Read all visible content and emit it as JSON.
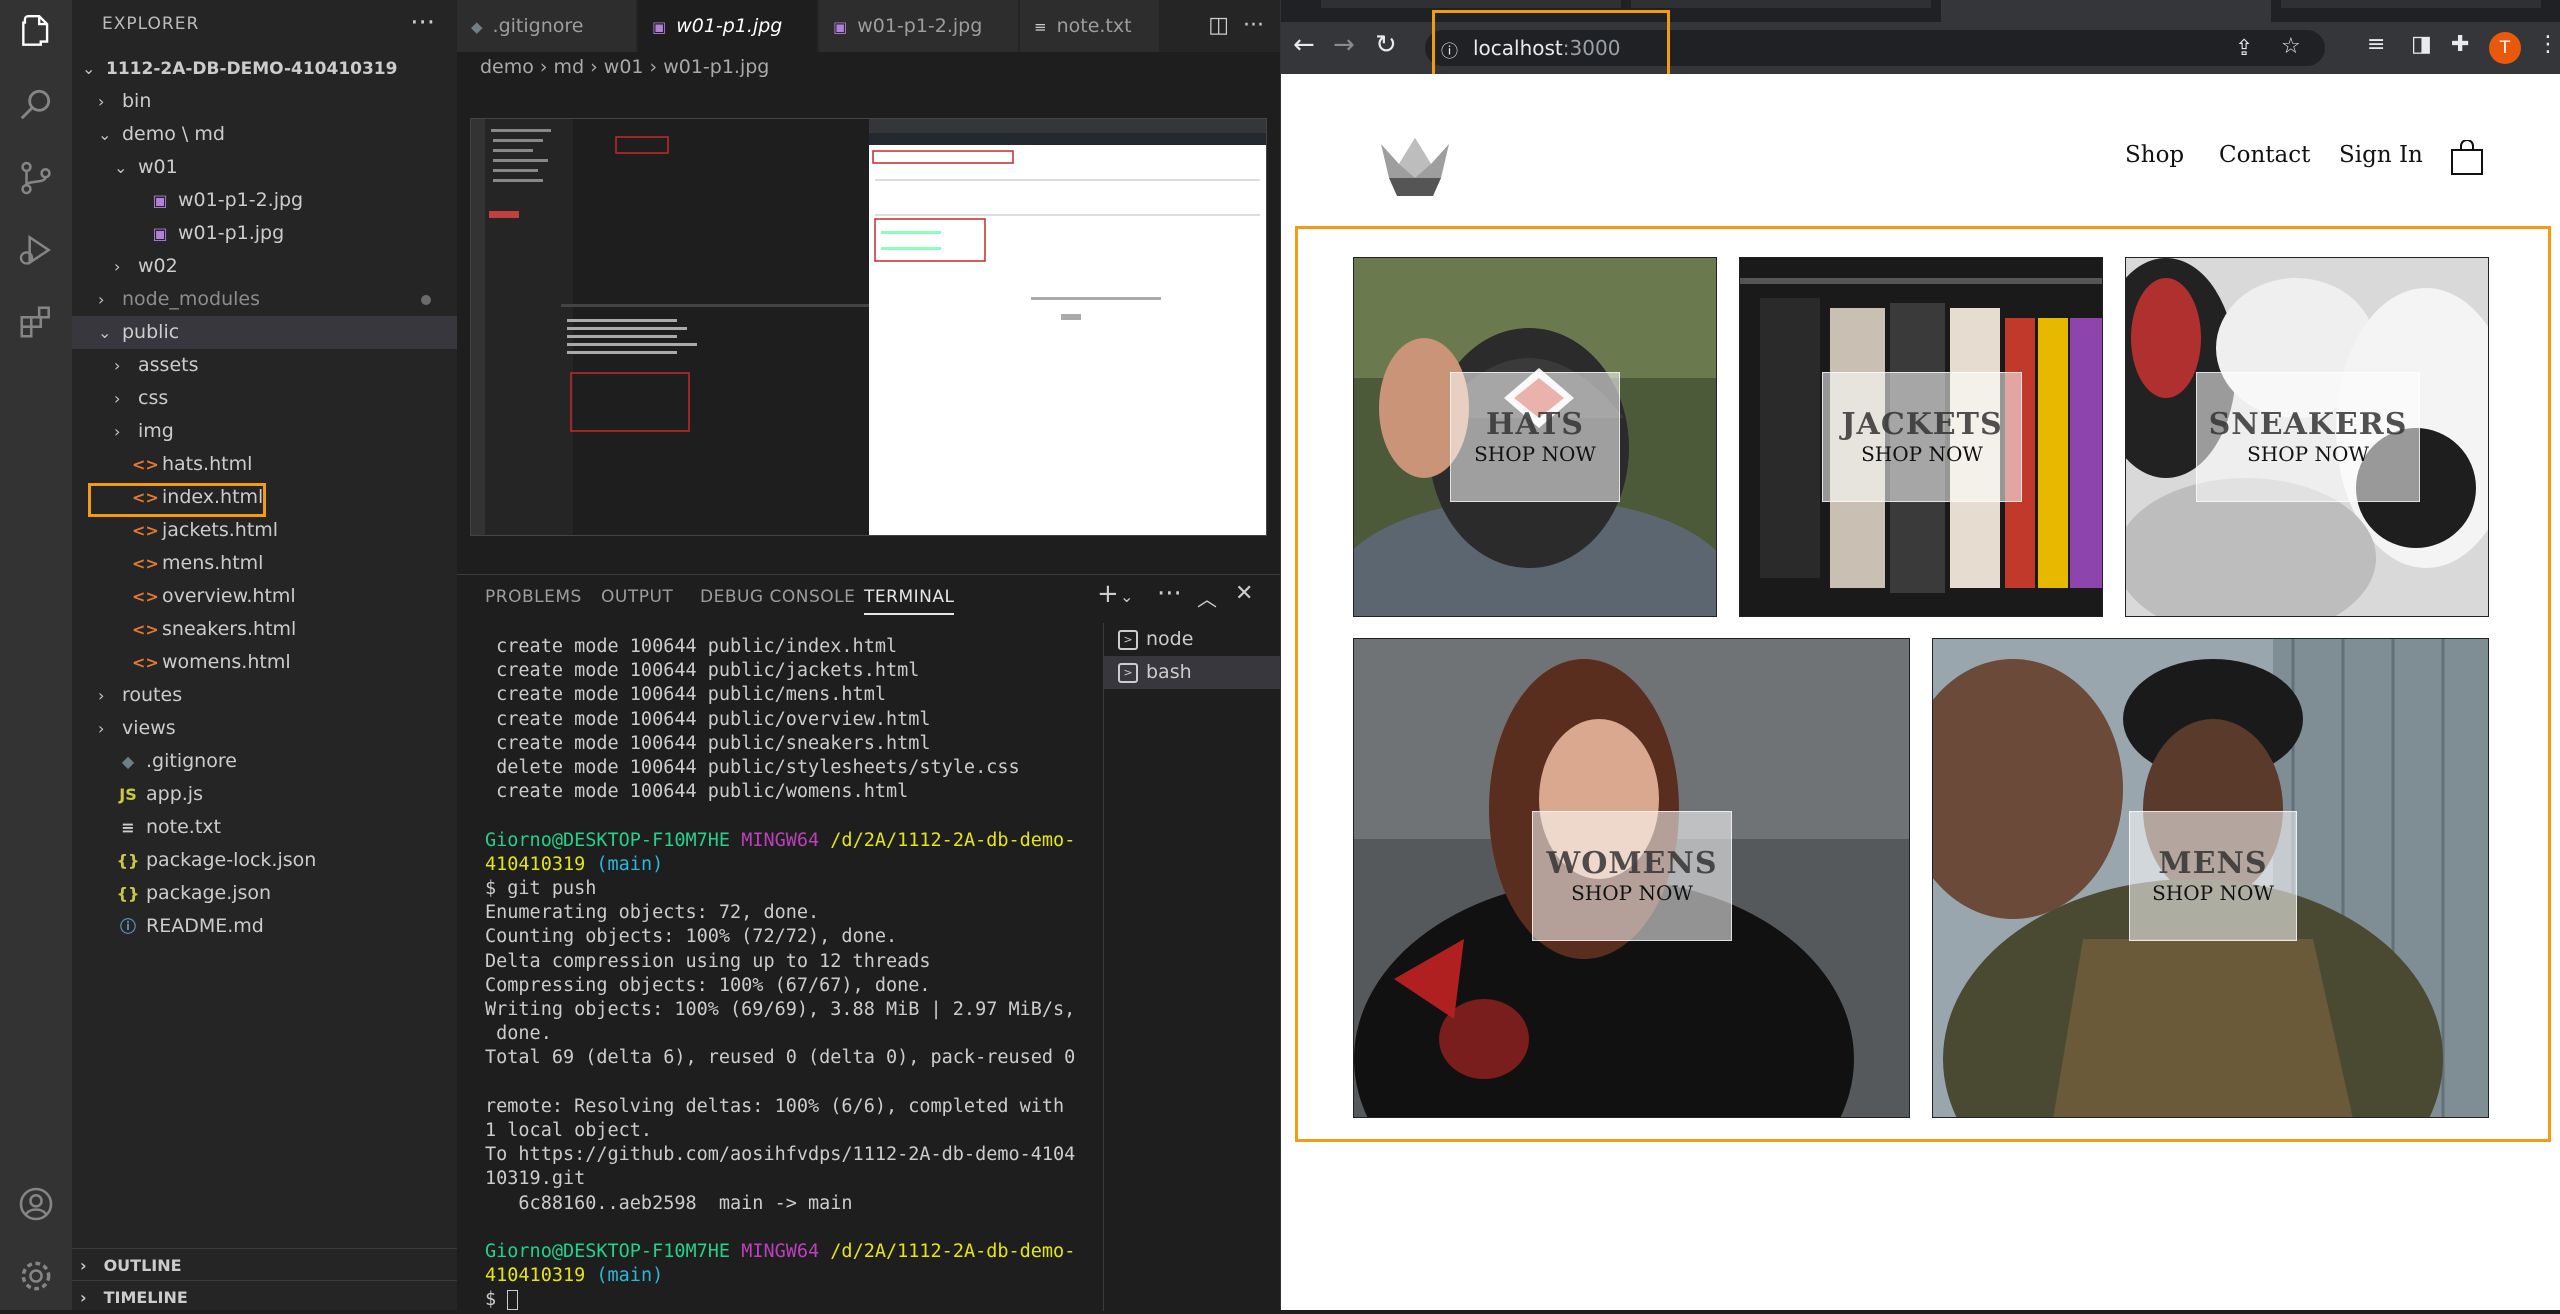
{
  "vscode": {
    "explorer_title": "EXPLORER",
    "more": "···",
    "tree": [
      {
        "label": "1112-2A-DB-DEMO-410410319",
        "chev": "⌄",
        "indent": 0,
        "icon": "",
        "bold": true
      },
      {
        "label": "bin",
        "chev": "›",
        "indent": 1,
        "icon": ""
      },
      {
        "label": "demo \\ md",
        "chev": "⌄",
        "indent": 1,
        "icon": ""
      },
      {
        "label": "w01",
        "chev": "⌄",
        "indent": 2,
        "icon": ""
      },
      {
        "label": "w01-p1-2.jpg",
        "chev": "",
        "indent": 3,
        "icon": "▣"
      },
      {
        "label": "w01-p1.jpg",
        "chev": "",
        "indent": 3,
        "icon": "▣"
      },
      {
        "label": "w02",
        "chev": "›",
        "indent": 2,
        "icon": ""
      },
      {
        "label": "node_modules",
        "chev": "›",
        "indent": 1,
        "icon": "",
        "dim": true
      },
      {
        "label": "public",
        "chev": "⌄",
        "indent": 1,
        "icon": "",
        "selected": true
      },
      {
        "label": "assets",
        "chev": "›",
        "indent": 2,
        "icon": ""
      },
      {
        "label": "css",
        "chev": "›",
        "indent": 2,
        "icon": ""
      },
      {
        "label": "img",
        "chev": "›",
        "indent": 2,
        "icon": ""
      },
      {
        "label": "hats.html",
        "chev": "",
        "indent": 2,
        "icon": "<>"
      },
      {
        "label": "index.html",
        "chev": "",
        "indent": 2,
        "icon": "<>"
      },
      {
        "label": "jackets.html",
        "chev": "",
        "indent": 2,
        "icon": "<>"
      },
      {
        "label": "mens.html",
        "chev": "",
        "indent": 2,
        "icon": "<>"
      },
      {
        "label": "overview.html",
        "chev": "",
        "indent": 2,
        "icon": "<>"
      },
      {
        "label": "sneakers.html",
        "chev": "",
        "indent": 2,
        "icon": "<>"
      },
      {
        "label": "womens.html",
        "chev": "",
        "indent": 2,
        "icon": "<>"
      },
      {
        "label": "routes",
        "chev": "›",
        "indent": 1,
        "icon": ""
      },
      {
        "label": "views",
        "chev": "›",
        "indent": 1,
        "icon": ""
      },
      {
        "label": ".gitignore",
        "chev": "",
        "indent": 1,
        "icon": "◆"
      },
      {
        "label": "app.js",
        "chev": "",
        "indent": 1,
        "icon": "JS"
      },
      {
        "label": "note.txt",
        "chev": "",
        "indent": 1,
        "icon": "≡"
      },
      {
        "label": "package-lock.json",
        "chev": "",
        "indent": 1,
        "icon": "{}"
      },
      {
        "label": "package.json",
        "chev": "",
        "indent": 1,
        "icon": "{}"
      },
      {
        "label": "README.md",
        "chev": "",
        "indent": 1,
        "icon": "ⓘ"
      }
    ],
    "outline": "OUTLINE",
    "timeline": "TIMELINE",
    "tabs": [
      ".gitignore",
      "w01-p1.jpg",
      "w01-p1-2.jpg",
      "note.txt"
    ],
    "breadcrumb": "demo  ›  md  ›  w01  ›  w01-p1.jpg",
    "panel_tabs": [
      "PROBLEMS",
      "OUTPUT",
      "DEBUG CONSOLE",
      "TERMINAL"
    ],
    "terminal_list": [
      "node",
      "bash"
    ],
    "terminal_lines": [
      " create mode 100644 public/index.html",
      " create mode 100644 public/jackets.html",
      " create mode 100644 public/mens.html",
      " create mode 100644 public/overview.html",
      " create mode 100644 public/sneakers.html",
      " delete mode 100644 public/stylesheets/style.css",
      " create mode 100644 public/womens.html"
    ],
    "prompt_user": "Giorno@DESKTOP-F10M7HE",
    "prompt_shell": "MINGW64",
    "prompt_path_1": "/d/2A/1112-2A-db-demo-",
    "prompt_path_2": "410410319",
    "prompt_branch": "(main)",
    "command": "$ git push",
    "push_output": [
      "Enumerating objects: 72, done.",
      "Counting objects: 100% (72/72), done.",
      "Delta compression using up to 12 threads",
      "Compressing objects: 100% (67/67), done.",
      "Writing objects: 100% (69/69), 3.88 MiB | 2.97 MiB/s,",
      " done.",
      "Total 69 (delta 6), reused 0 (delta 0), pack-reused 0",
      "",
      "remote: Resolving deltas: 100% (6/6), completed with",
      "1 local object.",
      "To https://github.com/aosihfvdps/1112-2A-db-demo-4104",
      "10319.git",
      "   6c88160..aeb2598  main -> main"
    ],
    "final_prompt": "$ "
  },
  "browser": {
    "url_host": "localhost",
    "url_path": ":3000",
    "avatar_letter": "T"
  },
  "site": {
    "nav": [
      "Shop",
      "Contact",
      "Sign In"
    ],
    "shop_now": "SHOP NOW",
    "categories": [
      "HATS",
      "JACKETS",
      "SNEAKERS",
      "WOMENS",
      "MENS"
    ]
  }
}
